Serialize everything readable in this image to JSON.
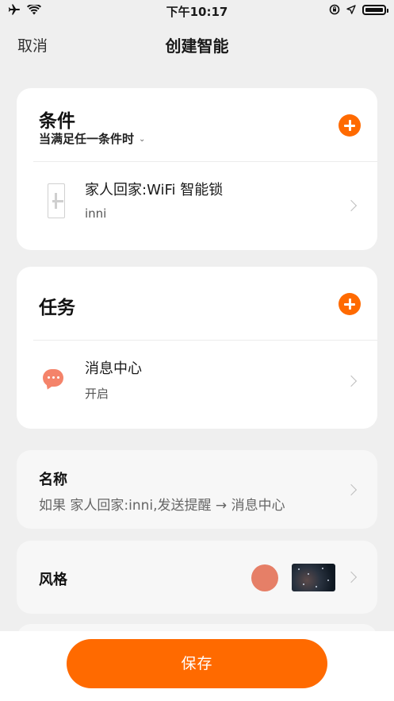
{
  "status_bar": {
    "time": "下午10:17"
  },
  "nav": {
    "cancel_label": "取消",
    "title": "创建智能"
  },
  "conditions": {
    "title": "条件",
    "match_mode": "当满足任一条件时",
    "items": [
      {
        "title": "家人回家:WiFi 智能锁",
        "subtitle": "inni",
        "icon": "door-lock-icon"
      }
    ]
  },
  "tasks": {
    "title": "任务",
    "items": [
      {
        "title": "消息中心",
        "subtitle": "开启",
        "icon": "message-icon"
      }
    ]
  },
  "name_field": {
    "label": "名称",
    "value": "如果 家人回家:inni,发送提醒 → 消息中心"
  },
  "style_field": {
    "label": "风格",
    "color": "#e67f67"
  },
  "footer": {
    "save_label": "保存"
  },
  "colors": {
    "accent": "#ff6a00",
    "background": "#efefef",
    "card": "#ffffff"
  }
}
